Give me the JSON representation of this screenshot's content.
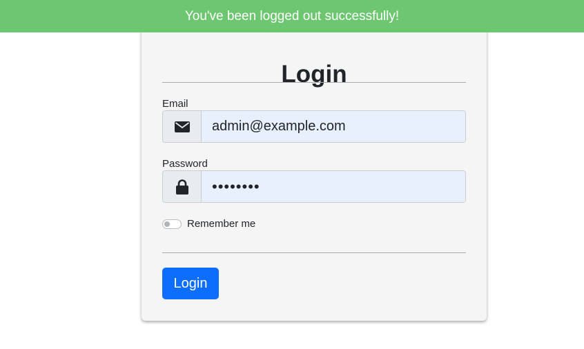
{
  "banner": {
    "message": "You've been logged out successfully!"
  },
  "form": {
    "title": "Login",
    "email": {
      "label": "Email",
      "value": "admin@example.com",
      "icon": "envelope-icon"
    },
    "password": {
      "label": "Password",
      "value": "••••••••",
      "icon": "lock-icon"
    },
    "remember": {
      "label": "Remember me",
      "checked": false
    },
    "submit_label": "Login"
  },
  "colors": {
    "banner_bg": "#6dc670",
    "primary": "#0d6efd",
    "autofill_bg": "#e8f0fe"
  }
}
